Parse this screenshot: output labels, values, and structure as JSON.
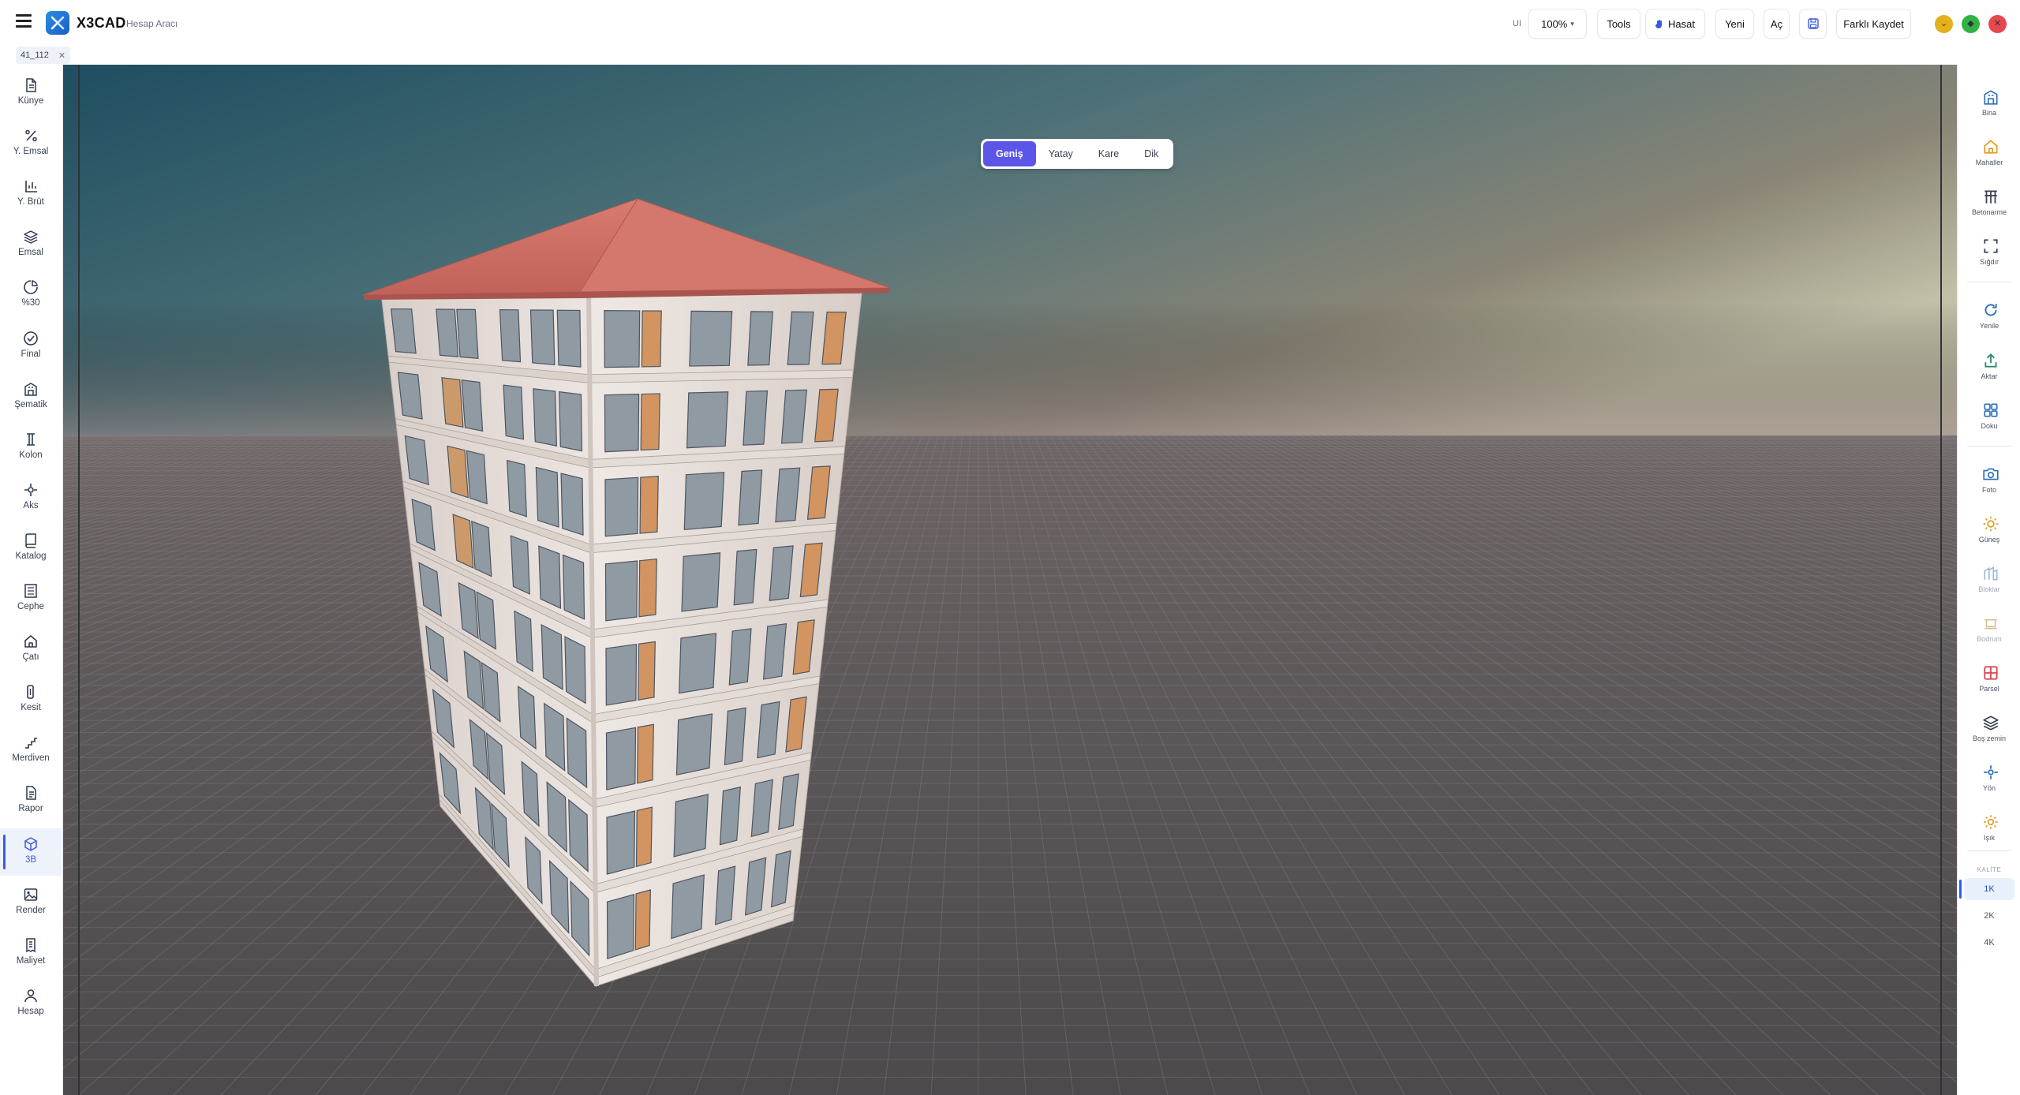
{
  "app": {
    "name": "X3CAD",
    "subtitle": "Hesap Aracı"
  },
  "toolbar": {
    "ui_label": "UI",
    "zoom": "100%",
    "tools": "Tools",
    "hasat": "Hasat",
    "new": "Yeni",
    "open": "Aç",
    "save_as": "Farklı Kaydet"
  },
  "colors": {
    "accent": "#5b55e8",
    "min": "#e3b11c",
    "max": "#2fb344",
    "close": "#e5484d",
    "roof": "#cc6e64",
    "wall": "#e6ddd8"
  },
  "tabs": [
    {
      "label": "41_112"
    }
  ],
  "left_sidebar": {
    "items": [
      {
        "label": "Künye",
        "icon": "document-icon"
      },
      {
        "label": "Y. Emsal",
        "icon": "percent-icon"
      },
      {
        "label": "Y. Brüt",
        "icon": "bar-chart-icon"
      },
      {
        "label": "Emsal",
        "icon": "layers-icon"
      },
      {
        "label": "%30",
        "icon": "pie-icon"
      },
      {
        "label": "Final",
        "icon": "check-circle-icon"
      },
      {
        "label": "Şematik",
        "icon": "building-icon"
      },
      {
        "label": "Kolon",
        "icon": "column-icon"
      },
      {
        "label": "Aks",
        "icon": "crosshair-icon"
      },
      {
        "label": "Katalog",
        "icon": "book-icon"
      },
      {
        "label": "Cephe",
        "icon": "facade-icon"
      },
      {
        "label": "Çatı",
        "icon": "home-icon"
      },
      {
        "label": "Kesit",
        "icon": "section-icon"
      },
      {
        "label": "Merdiven",
        "icon": "stairs-icon"
      },
      {
        "label": "Rapor",
        "icon": "report-icon"
      },
      {
        "label": "3B",
        "icon": "cube-icon",
        "active": true
      },
      {
        "label": "Render",
        "icon": "image-icon"
      },
      {
        "label": "Maliyet",
        "icon": "receipt-icon"
      },
      {
        "label": "Hesap",
        "icon": "user-icon"
      }
    ]
  },
  "view_modes": {
    "wide": "Geniş",
    "horizontal": "Yatay",
    "square": "Kare",
    "vertical": "Dik",
    "selected": "Geniş"
  },
  "right_sidebar": {
    "items": [
      {
        "label": "Bina",
        "icon": "building-icon"
      },
      {
        "label": "Mahaller",
        "icon": "home-icon"
      },
      {
        "label": "Betonarme",
        "icon": "frame-icon"
      },
      {
        "label": "Sığdır",
        "icon": "fit-icon"
      },
      {
        "label": "Yenile",
        "icon": "refresh-icon"
      },
      {
        "label": "Aktar",
        "icon": "export-icon"
      },
      {
        "label": "Doku",
        "icon": "grid-icon"
      },
      {
        "label": "Foto",
        "icon": "camera-icon"
      },
      {
        "label": "Güneş",
        "icon": "sun-icon"
      },
      {
        "label": "Bloklar",
        "icon": "blocks-icon",
        "disabled": true
      },
      {
        "label": "Bodrum",
        "icon": "basement-icon",
        "disabled": true
      },
      {
        "label": "Parsel",
        "icon": "parcel-icon"
      },
      {
        "label": "Boş zemin",
        "icon": "layers-icon"
      },
      {
        "label": "Yön",
        "icon": "compass-icon"
      },
      {
        "label": "Işık",
        "icon": "light-icon"
      }
    ],
    "quality_label": "KALİTE",
    "quality": [
      {
        "label": "1K",
        "active": true
      },
      {
        "label": "2K"
      },
      {
        "label": "4K"
      }
    ]
  }
}
